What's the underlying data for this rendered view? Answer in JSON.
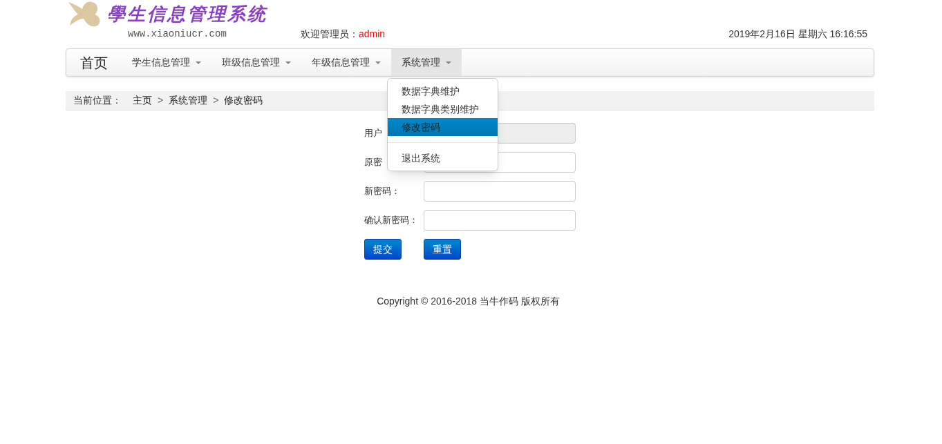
{
  "logo": {
    "title": "學生信息管理系统",
    "url": "www.xiaoniucr.com"
  },
  "welcome": {
    "label": "欢迎管理员：",
    "user": "admin"
  },
  "datetime": "2019年2月16日 星期六 16:16:55",
  "nav": {
    "brand": "首页",
    "items": [
      {
        "label": "学生信息管理",
        "selected": false
      },
      {
        "label": "班级信息管理",
        "selected": false
      },
      {
        "label": "年级信息管理",
        "selected": false
      },
      {
        "label": "系统管理",
        "selected": true
      }
    ]
  },
  "dropdown": [
    {
      "kind": "item",
      "label": "数据字典维护",
      "selected": false
    },
    {
      "kind": "item",
      "label": "数据字典类别维护",
      "selected": false
    },
    {
      "kind": "item",
      "label": "修改密码",
      "selected": true
    },
    {
      "kind": "divider"
    },
    {
      "kind": "item",
      "label": "退出系统",
      "selected": false
    }
  ],
  "breadcrumb": {
    "label": "当前位置：",
    "separator": ">",
    "items": [
      "主页",
      "系统管理",
      "修改密码"
    ]
  },
  "form": {
    "fields": [
      {
        "label": "用户",
        "disabled": true
      },
      {
        "label": "原密",
        "disabled": false
      },
      {
        "label": "新密码：",
        "disabled": false
      },
      {
        "label": "确认新密码：",
        "disabled": false
      }
    ],
    "buttons": [
      "提交",
      "重置"
    ]
  },
  "footer": "Copyright © 2016-2018 当牛作码 版权所有"
}
